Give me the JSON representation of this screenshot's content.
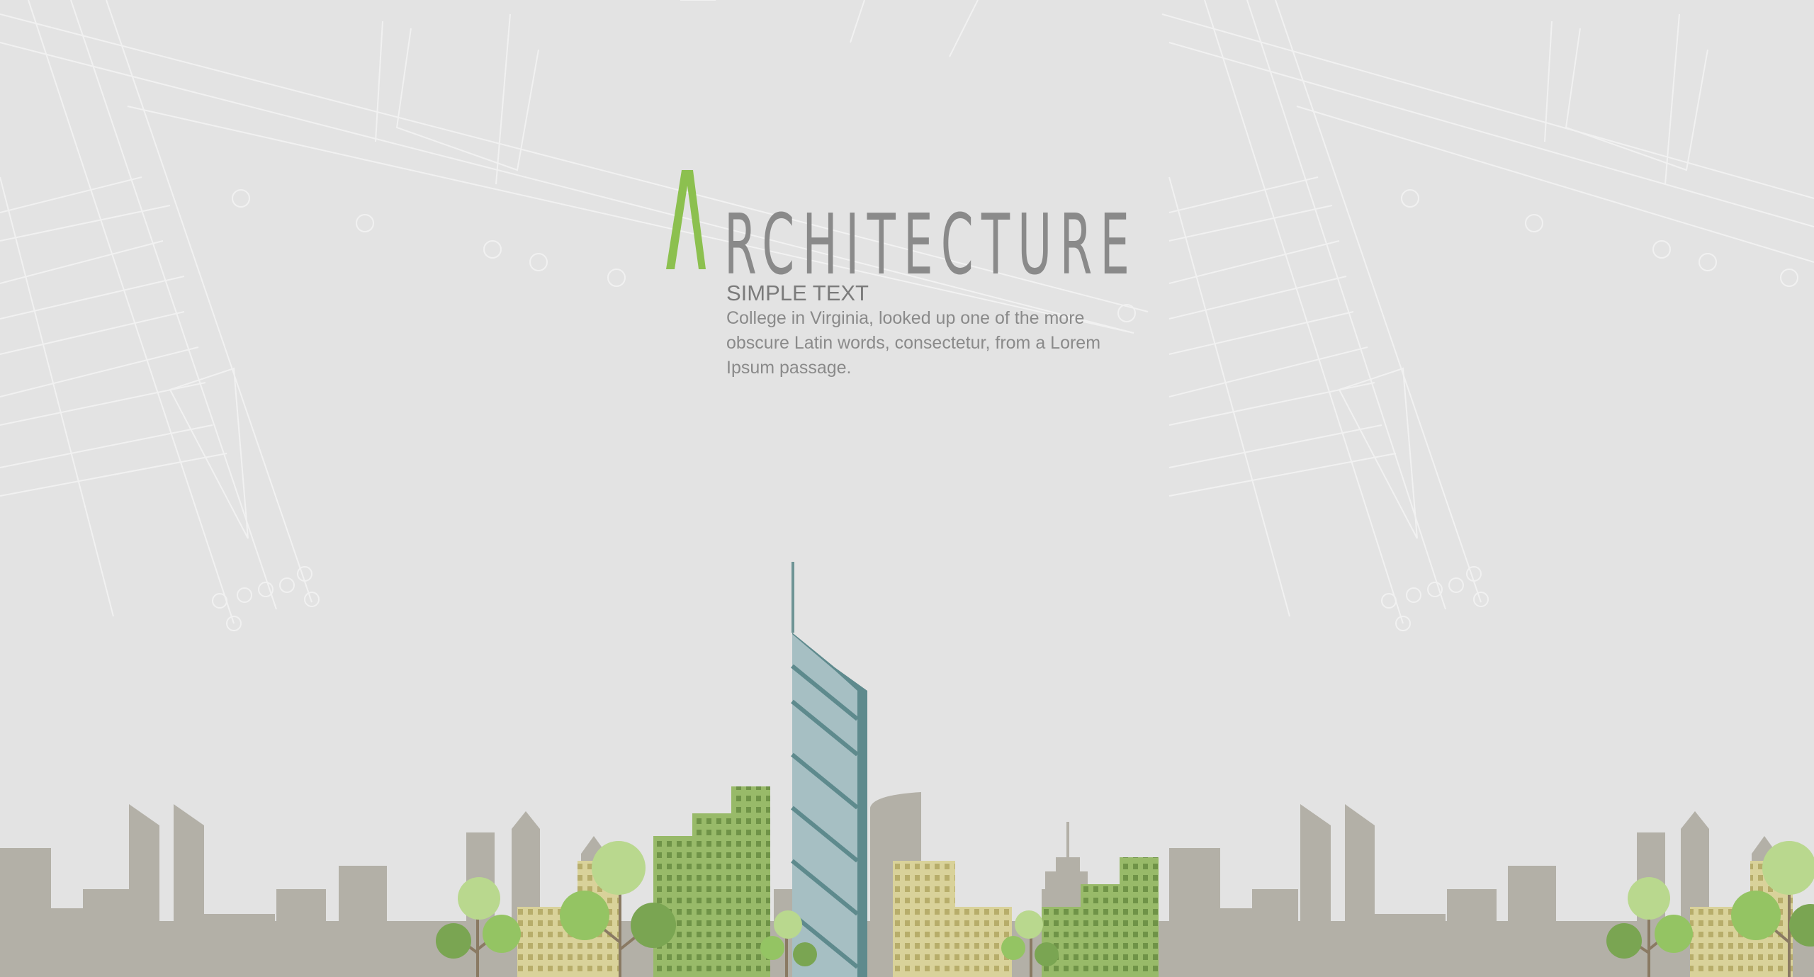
{
  "title": {
    "first_letter": "A",
    "rest": "RCHITECTURE"
  },
  "subtitle": "SIMPLE TEXT",
  "body": "College in Virginia, looked up one of the more obscure Latin words, consectetur, from a Lorem Ipsum passage.",
  "colors": {
    "background": "#e3e3e3",
    "accent_green": "#8cc04f",
    "title_gray": "#8a8a8a",
    "skyline_gray": "#b3b0a7",
    "glass_tower": "#a6bfc3",
    "glass_tower_edge": "#5e8a8d",
    "green_building": "#98ba69",
    "sand_building": "#d9d29a",
    "tree_light": "#b9d88e",
    "tree_mid": "#94c463",
    "tree_dark": "#7aa552",
    "trunk": "#8a7a63"
  }
}
